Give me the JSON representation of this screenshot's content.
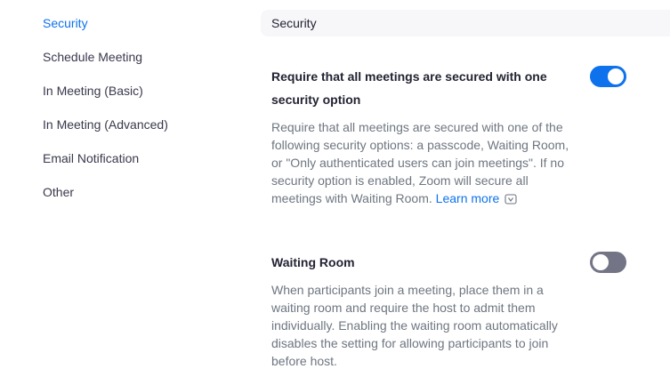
{
  "sidebar": {
    "items": [
      {
        "label": "Security",
        "active": true
      },
      {
        "label": "Schedule Meeting",
        "active": false
      },
      {
        "label": "In Meeting (Basic)",
        "active": false
      },
      {
        "label": "In Meeting (Advanced)",
        "active": false
      },
      {
        "label": "Email Notification",
        "active": false
      },
      {
        "label": "Other",
        "active": false
      }
    ]
  },
  "main": {
    "section_title": "Security",
    "settings": [
      {
        "title": "Require that all meetings are secured with one security option",
        "description": "Require that all meetings are secured with one of the following security options: a passcode, Waiting Room, or \"Only authenticated users can join meetings\". If no security option is enabled, Zoom will secure all meetings with Waiting Room.",
        "link_label": "Learn more",
        "link_icon": "external-link-icon",
        "enabled": true
      },
      {
        "title": "Waiting Room",
        "description": "When participants join a meeting, place them in a waiting room and require the host to admit them individually. Enabling the waiting room automatically disables the setting for allowing participants to join before host.",
        "enabled": false
      }
    ]
  },
  "colors": {
    "accent": "#0e72ed",
    "toggle_off": "#747487",
    "header_bg": "#f7f7fa",
    "description_text": "#6e7680"
  }
}
